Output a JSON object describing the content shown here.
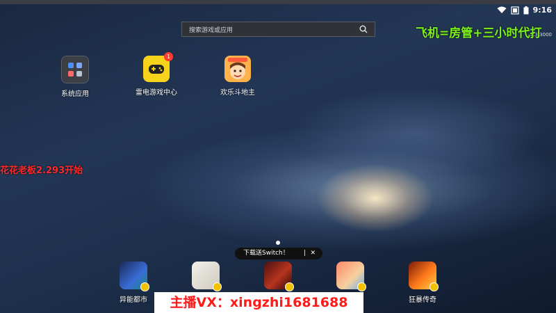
{
  "search": {
    "placeholder": "搜索游戏或应用"
  },
  "status": {
    "time": "9:16",
    "sub_text": "2.3.3000"
  },
  "overlays": {
    "top_right": "飞机=房管+三小时代打",
    "left": "花花老板2.293开始",
    "bottom": "主播VX：xingzhi1681688"
  },
  "desktop_apps": [
    {
      "label": "系统应用"
    },
    {
      "label": "雷电游戏中心",
      "badge": "1"
    },
    {
      "label": "欢乐斗地主"
    }
  ],
  "tooltip": {
    "text": "下载送Switch！",
    "separator": "|",
    "close": "✕"
  },
  "dock_apps": [
    {
      "label": "异能都市"
    },
    {
      "label": ""
    },
    {
      "label": ""
    },
    {
      "label": ""
    },
    {
      "label": "狂暴传奇"
    }
  ]
}
